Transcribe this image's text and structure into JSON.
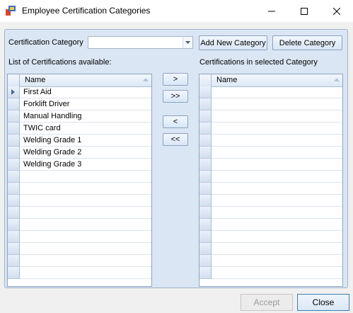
{
  "window": {
    "title": "Employee Certification Categories",
    "controls": {
      "minimize": "─",
      "maximize": "☐",
      "close": "✕"
    }
  },
  "category": {
    "label": "Certification Category",
    "value": "",
    "add_button": "Add New Category",
    "delete_button": "Delete Category"
  },
  "available": {
    "label": "List of Certifications available:",
    "column": "Name",
    "items": [
      "First Aid",
      "Forklift Driver",
      "Manual Handling",
      "TWIC card",
      "Welding Grade 1",
      "Welding Grade 2",
      "Welding Grade 3"
    ]
  },
  "selected": {
    "label": "Certifications in selected Category",
    "column": "Name",
    "items": []
  },
  "transfer": {
    "add_one": ">",
    "add_all": ">>",
    "remove_one": "<",
    "remove_all": "<<"
  },
  "footer": {
    "accept": "Accept",
    "close": "Close"
  },
  "colors": {
    "panel": "#dbe6f4",
    "border": "#8ea4c1",
    "close_border": "#3c7fb1"
  }
}
